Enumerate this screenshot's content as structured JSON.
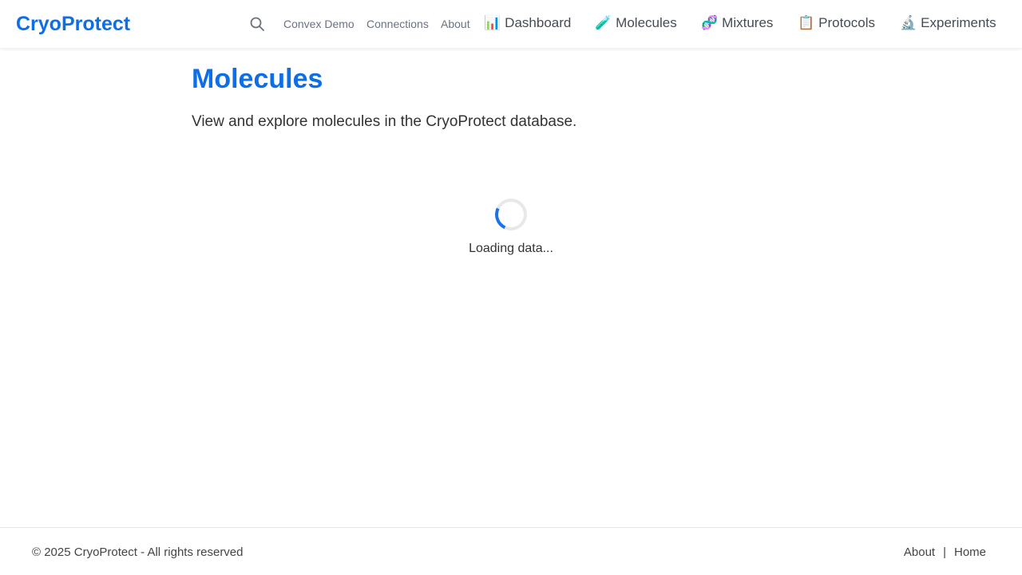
{
  "header": {
    "brand": "CryoProtect",
    "search_icon": "search-icon",
    "links": {
      "convex_demo": "Convex Demo",
      "connections": "Connections",
      "about": "About"
    },
    "nav": [
      {
        "icon": "📊",
        "icon_name": "bar-chart-icon",
        "label": "Dashboard"
      },
      {
        "icon": "🧪",
        "icon_name": "test-tube-icon",
        "label": "Molecules"
      },
      {
        "icon": "🧬",
        "icon_name": "dna-icon",
        "label": "Mixtures"
      },
      {
        "icon": "📋",
        "icon_name": "clipboard-icon",
        "label": "Protocols"
      },
      {
        "icon": "🔬",
        "icon_name": "microscope-icon",
        "label": "Experiments"
      }
    ]
  },
  "main": {
    "title": "Molecules",
    "description": "View and explore molecules in the CryoProtect database.",
    "loading_text": "Loading data..."
  },
  "footer": {
    "copyright": "© 2025 CryoProtect - All rights reserved",
    "links": {
      "about": "About",
      "separator": "|",
      "home": "Home"
    }
  },
  "colors": {
    "brand": "#0d6ee6",
    "spinner": "#1a73e8"
  }
}
